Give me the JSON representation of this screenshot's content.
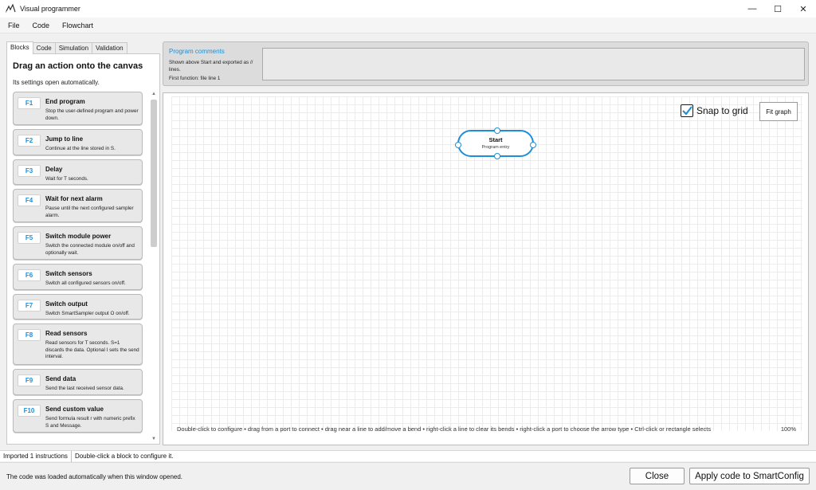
{
  "window": {
    "title": "Visual programmer",
    "icon": "visual-programmer-app-icon",
    "controls": {
      "minimize": "—",
      "maximize": "☐",
      "close": "✕"
    }
  },
  "menu": [
    "File",
    "Code",
    "Flowchart"
  ],
  "left_panel": {
    "tabs": [
      "Blocks",
      "Code",
      "Simulation",
      "Validation"
    ],
    "active_tab": "Blocks",
    "heading": "Drag an action onto the canvas",
    "subheading": "Its settings open automatically.",
    "blocks": [
      {
        "key": "F1",
        "title": "End program",
        "desc": "Stop the user-defined program and power down."
      },
      {
        "key": "F2",
        "title": "Jump to line",
        "desc": "Continue at the line stored in S."
      },
      {
        "key": "F3",
        "title": "Delay",
        "desc": "Wait for T seconds."
      },
      {
        "key": "F4",
        "title": "Wait for next alarm",
        "desc": "Pause until the next configured sampler alarm."
      },
      {
        "key": "F5",
        "title": "Switch module power",
        "desc": "Switch the connected module on/off and optionally wait."
      },
      {
        "key": "F6",
        "title": "Switch sensors",
        "desc": "Switch all configured sensors on/off."
      },
      {
        "key": "F7",
        "title": "Switch output",
        "desc": "Switch SmartSampler output O on/off."
      },
      {
        "key": "F8",
        "title": "Read sensors",
        "desc": "Read sensors for T seconds. S=1 discards the data. Optional I sets the send interval."
      },
      {
        "key": "F9",
        "title": "Send data",
        "desc": "Send the last received sensor data."
      },
      {
        "key": "F10",
        "title": "Send custom value",
        "desc": "Send formula result r with numeric prefix S and Message."
      }
    ]
  },
  "comments": {
    "title": "Program comments",
    "help": "Shown above Start and exported as // lines.",
    "first_function": "First function: file line 1",
    "value": ""
  },
  "canvas": {
    "snap_to_grid_label": "Snap to grid",
    "snap_to_grid_checked": true,
    "fit_graph_label": "Fit graph",
    "start_node": {
      "title": "Start",
      "subtitle": "Program entry"
    },
    "hint": "Double-click to configure • drag from a port to connect • drag near a line to add/move a bend • right-click a line to clear its bends • right-click a port to choose the arrow type • Ctrl-click or rectangle selects",
    "zoom": "100%"
  },
  "status": {
    "left": "Imported 1 instructions",
    "right": "Double-click a block to configure it."
  },
  "footer": {
    "message": "The code was loaded automatically when this window opened.",
    "close_label": "Close",
    "apply_label": "Apply code to SmartConfig"
  }
}
